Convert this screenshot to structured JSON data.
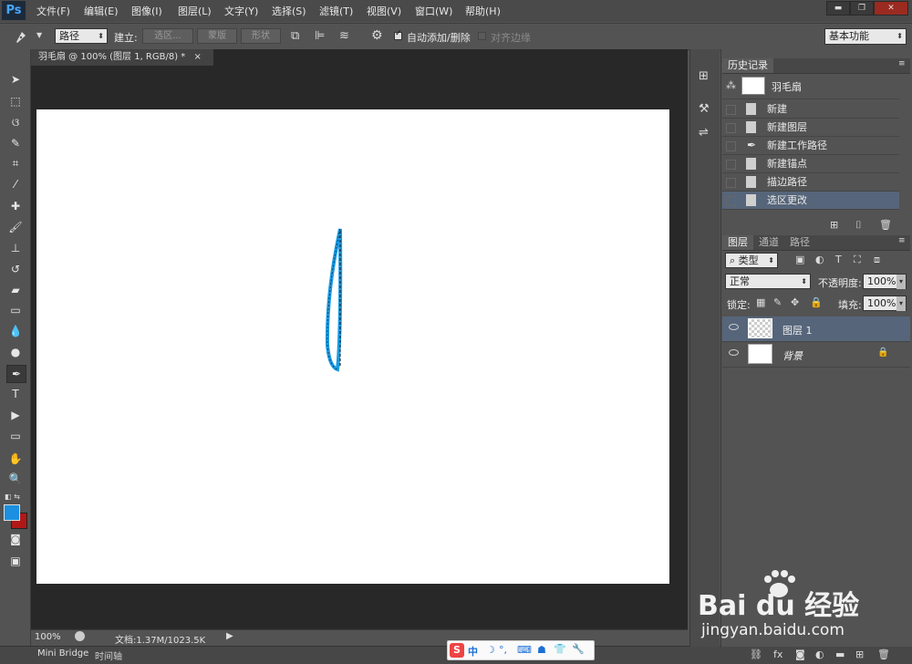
{
  "app": {
    "logo": "Ps"
  },
  "menu": [
    "文件(F)",
    "编辑(E)",
    "图像(I)",
    "图层(L)",
    "文字(Y)",
    "选择(S)",
    "滤镜(T)",
    "视图(V)",
    "窗口(W)",
    "帮助(H)"
  ],
  "window_controls": [
    "▬",
    "❐",
    "✕"
  ],
  "options": {
    "tool_mode": "路径",
    "make_label": "建立:",
    "selection_btn": "选区...",
    "mask_btn": "蒙版",
    "shape_btn": "形状",
    "auto_add_delete": "自动添加/删除",
    "auto_add_checked": true,
    "align_edges": "对齐边缘",
    "workspace": "基本功能"
  },
  "document": {
    "tab_title": "羽毛扇 @ 100% (图层 1, RGB/8) *",
    "zoom": "100%",
    "doc_info": "文档:1.37M/1023.5K"
  },
  "bottom_tabs": [
    "Mini Bridge",
    "时间轴"
  ],
  "history": {
    "title": "历史记录",
    "snapshot": "羽毛扇",
    "items": [
      "新建",
      "新建图层",
      "新建工作路径",
      "新建锚点",
      "描边路径",
      "选区更改"
    ],
    "selected_index": 5
  },
  "layers": {
    "tabs": [
      "图层",
      "通道",
      "路径"
    ],
    "filter_kind": "类型",
    "blend_mode": "正常",
    "opacity_label": "不透明度:",
    "opacity_value": "100%",
    "lock_label": "锁定:",
    "fill_label": "填充:",
    "fill_value": "100%",
    "items": [
      {
        "name": "图层 1",
        "selected": true
      },
      {
        "name": "背景",
        "selected": false
      }
    ]
  },
  "watermark": {
    "brand": "Bai du 经验",
    "url": "jingyan.baidu.com"
  },
  "ime_bar": [
    "S",
    "中",
    "☽",
    "°,",
    "⌨",
    "☗",
    "👕",
    "🔧"
  ],
  "colors": {
    "foreground": "#1c8fe0",
    "background": "#b01818",
    "accent_selected": "#56657a",
    "feather_stroke": "#1d9be0"
  }
}
